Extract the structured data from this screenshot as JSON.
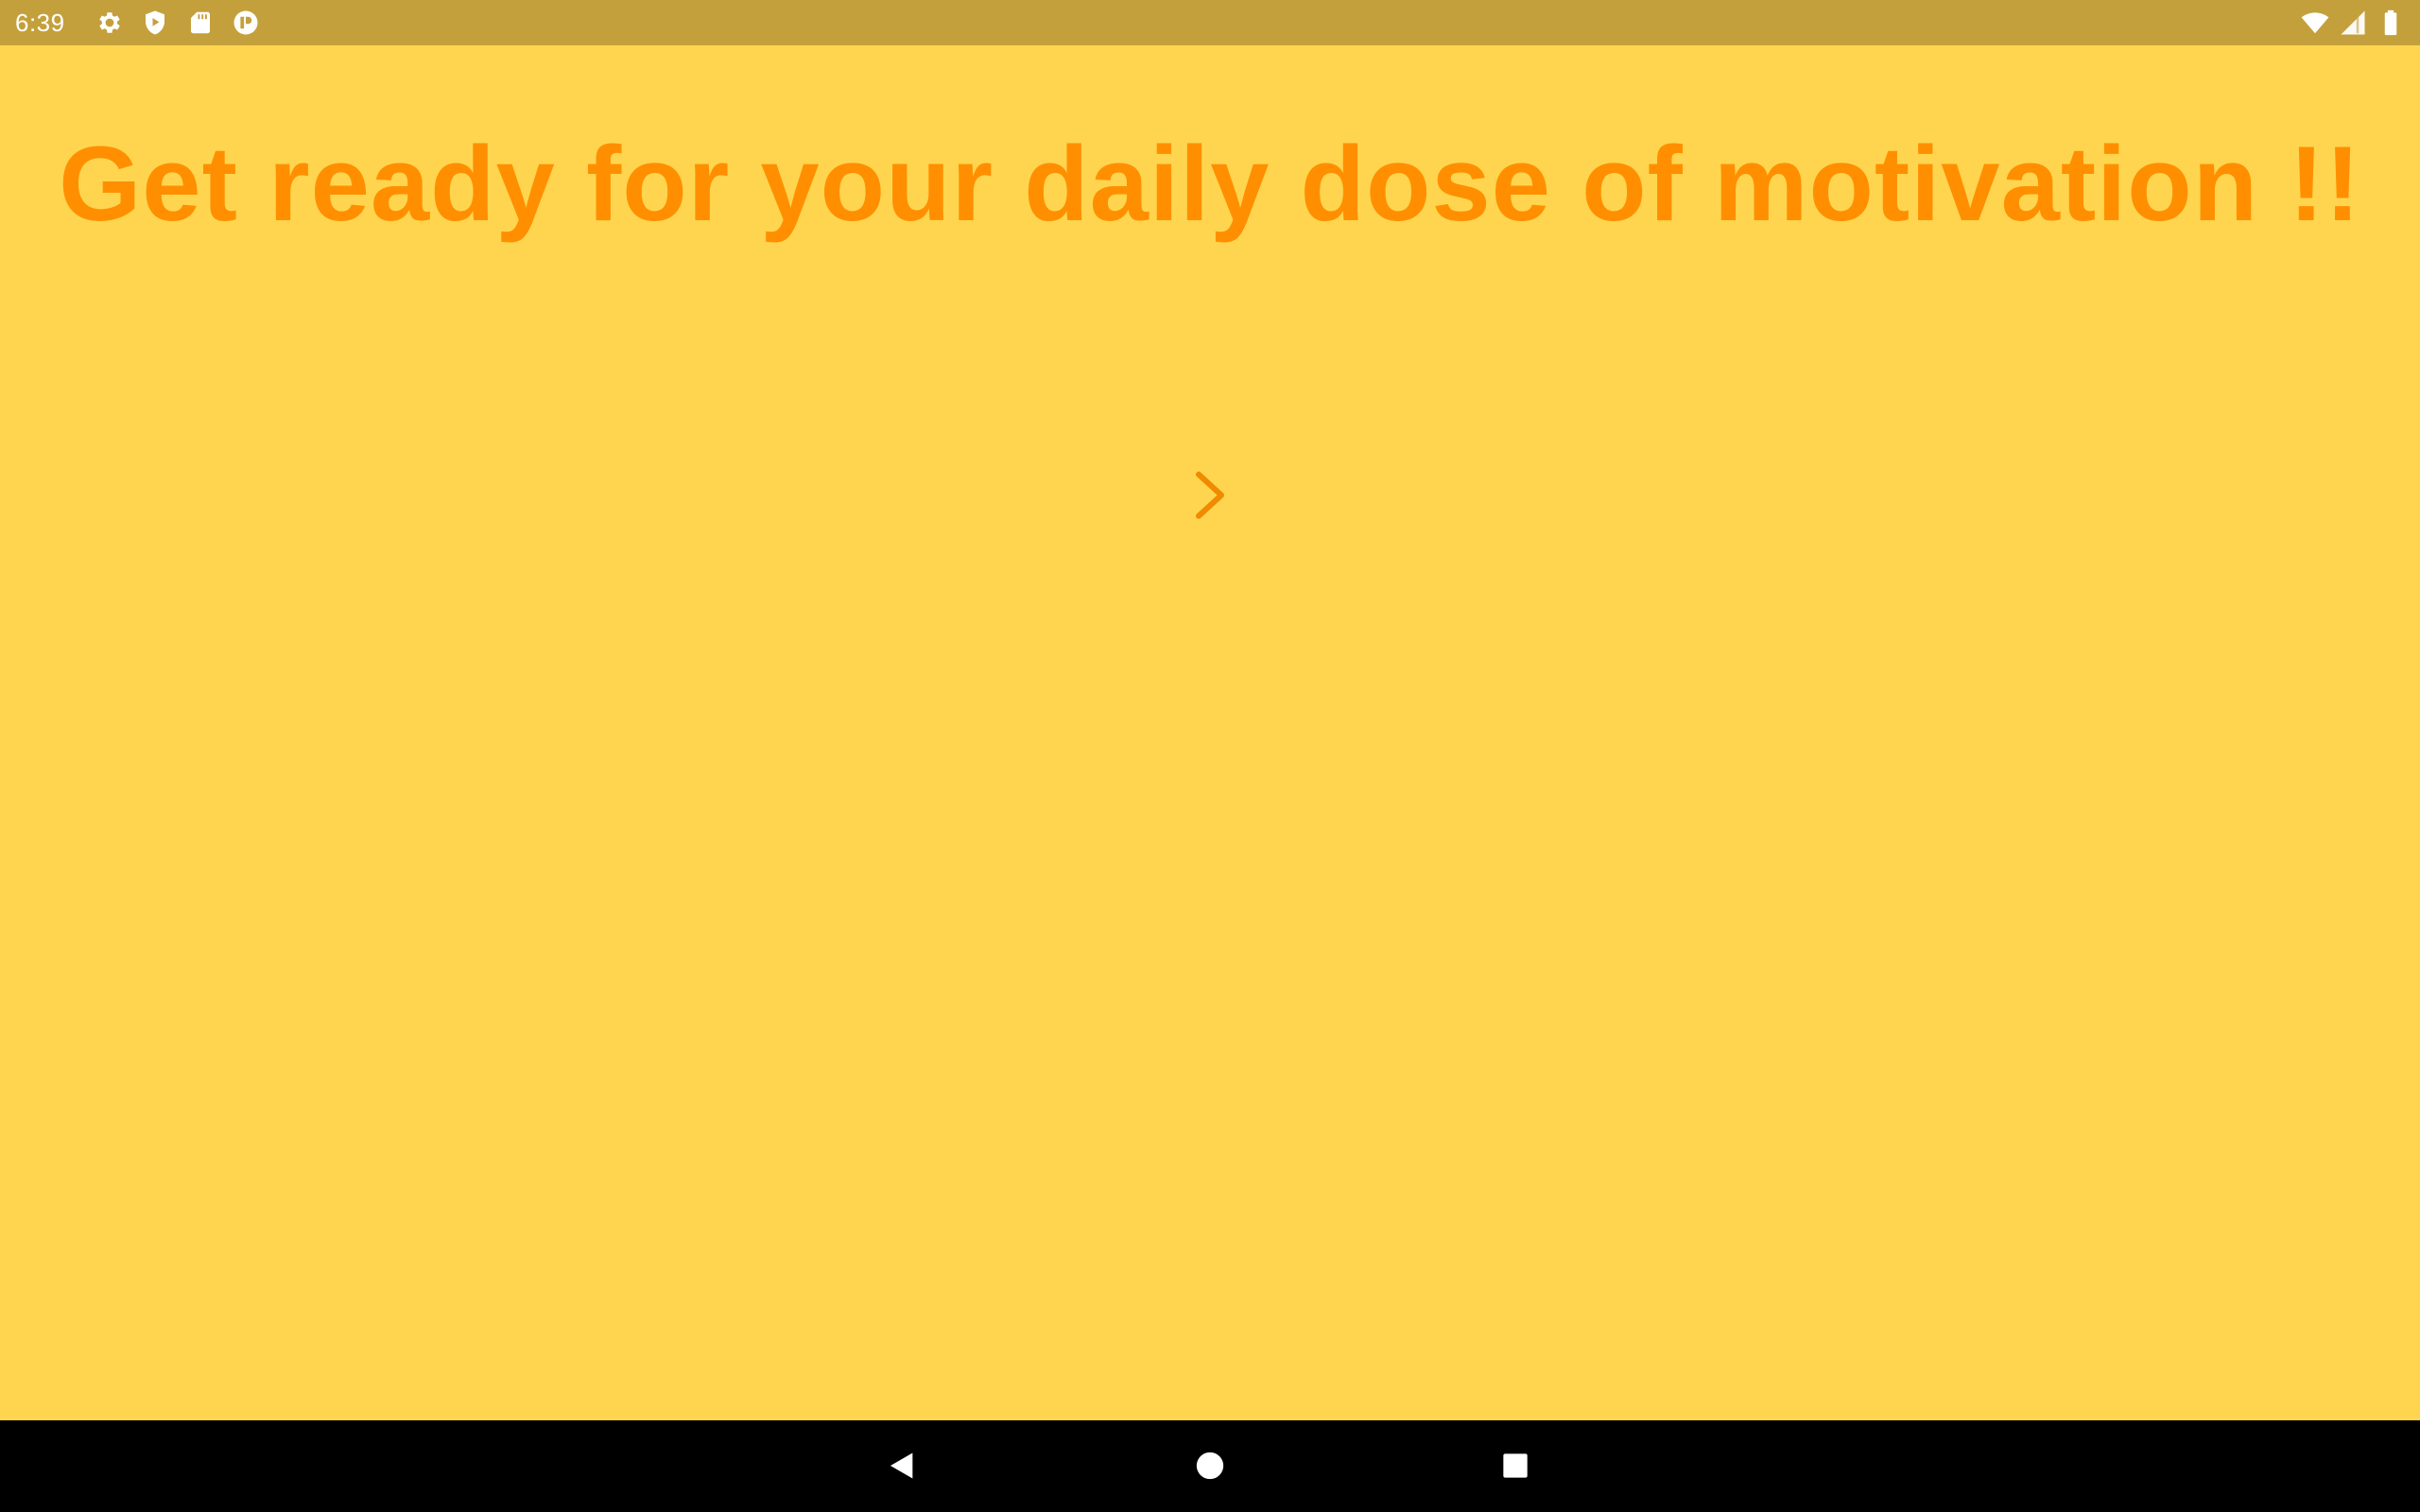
{
  "status_bar": {
    "time": "6:39",
    "left_icons": [
      "gear-icon",
      "shield-play-icon",
      "sd-card-icon",
      "app-circle-icon"
    ],
    "right_icons": [
      "wifi-icon",
      "cell-signal-icon",
      "battery-icon"
    ],
    "background_color": "#C4A03C"
  },
  "main": {
    "headline": "Get ready for your daily dose of motivation !!",
    "headline_color": "#FF8F00",
    "background_color": "#FFD54F",
    "next_icon": "chevron-right-icon"
  },
  "nav_bar": {
    "buttons": [
      "back-icon",
      "home-icon",
      "recents-icon"
    ],
    "background_color": "#000000"
  }
}
